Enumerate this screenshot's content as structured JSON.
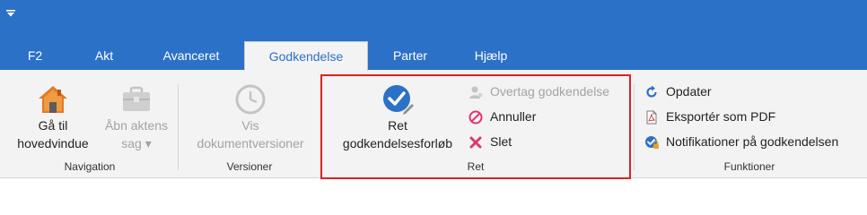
{
  "tabs": [
    {
      "label": "F2"
    },
    {
      "label": "Akt"
    },
    {
      "label": "Avanceret"
    },
    {
      "label": "Godkendelse"
    },
    {
      "label": "Parter"
    },
    {
      "label": "Hjælp"
    }
  ],
  "active_tab": "Godkendelse",
  "groups": {
    "navigation": {
      "label": "Navigation",
      "home": {
        "line1": "Gå til",
        "line2": "hovedvindue",
        "icon": "house-icon"
      },
      "open_case": {
        "line1": "Åbn aktens",
        "line2": "sag ▾",
        "icon": "briefcase-icon",
        "disabled": true
      }
    },
    "versioner": {
      "label": "Versioner",
      "show_versions": {
        "line1": "Vis",
        "line2": "dokumentversioner",
        "icon": "clock-icon",
        "disabled": true
      }
    },
    "ret": {
      "label": "Ret",
      "edit_flow": {
        "line1": "Ret",
        "line2": "godkendelsesforløb",
        "icon": "check-edit-icon"
      },
      "takeover": {
        "label": "Overtag godkendelse",
        "icon": "user-icon",
        "disabled": true
      },
      "cancel": {
        "label": "Annuller",
        "icon": "cancel-icon"
      },
      "delete": {
        "label": "Slet",
        "icon": "delete-icon"
      }
    },
    "funktioner": {
      "label": "Funktioner",
      "refresh": {
        "label": "Opdater",
        "icon": "refresh-icon"
      },
      "export_pdf": {
        "label": "Eksportér som PDF",
        "icon": "pdf-document-icon"
      },
      "notifications": {
        "label": "Notifikationer på godkendelsen",
        "icon": "check-lock-icon"
      }
    }
  },
  "colors": {
    "title_bar": "#2b71c8",
    "ribbon_bg": "#f3f3f3",
    "highlight": "#e02020"
  }
}
